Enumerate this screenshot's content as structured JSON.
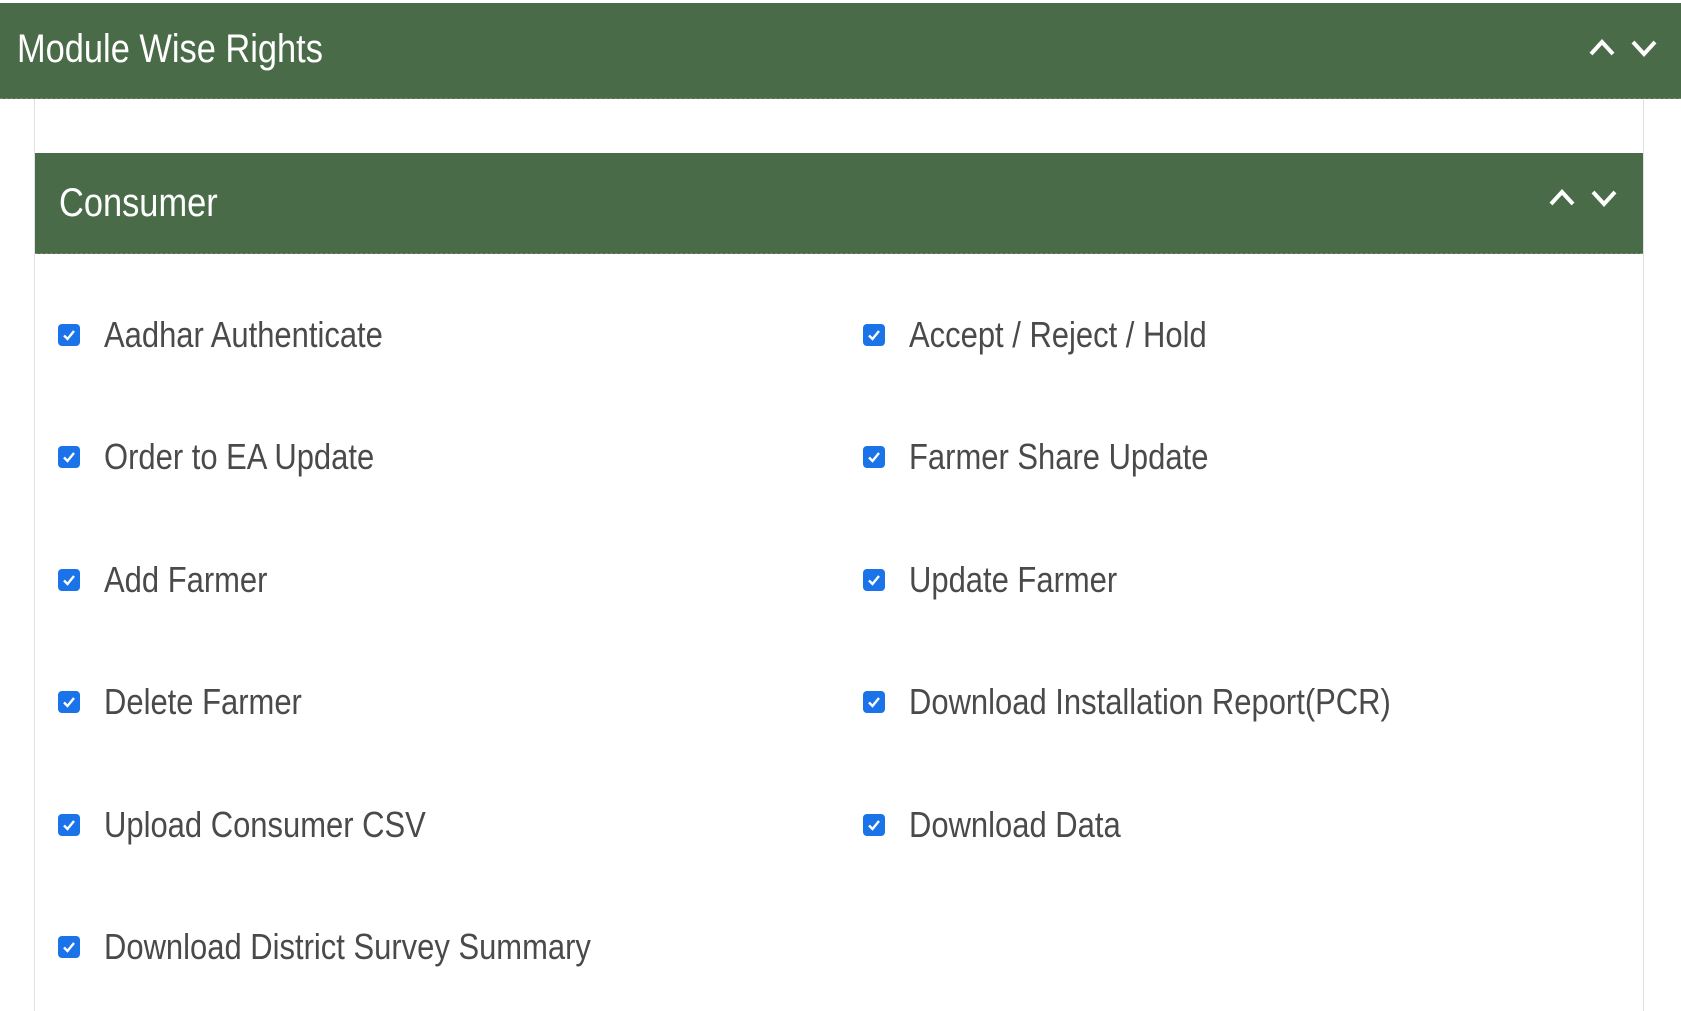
{
  "outer_section": {
    "title": "Module Wise Rights"
  },
  "inner_section": {
    "title": "Consumer"
  },
  "rights": [
    {
      "label": "Aadhar Authenticate",
      "checked": true
    },
    {
      "label": "Accept / Reject / Hold",
      "checked": true
    },
    {
      "label": "Order to EA Update",
      "checked": true
    },
    {
      "label": "Farmer Share Update",
      "checked": true
    },
    {
      "label": "Add Farmer",
      "checked": true
    },
    {
      "label": "Update Farmer",
      "checked": true
    },
    {
      "label": "Delete Farmer",
      "checked": true
    },
    {
      "label": "Download Installation Report(PCR)",
      "checked": true
    },
    {
      "label": "Upload Consumer CSV",
      "checked": true
    },
    {
      "label": "Download Data",
      "checked": true
    },
    {
      "label": "Download District Survey Summary",
      "checked": true
    }
  ],
  "colors": {
    "header_bg": "#4a6b48",
    "checkbox": "#1a73e8",
    "label_text": "#4a4a4a"
  },
  "icons": {
    "collapse": "chevron-up-icon",
    "expand": "chevron-down-icon",
    "check": "checkmark-icon"
  }
}
